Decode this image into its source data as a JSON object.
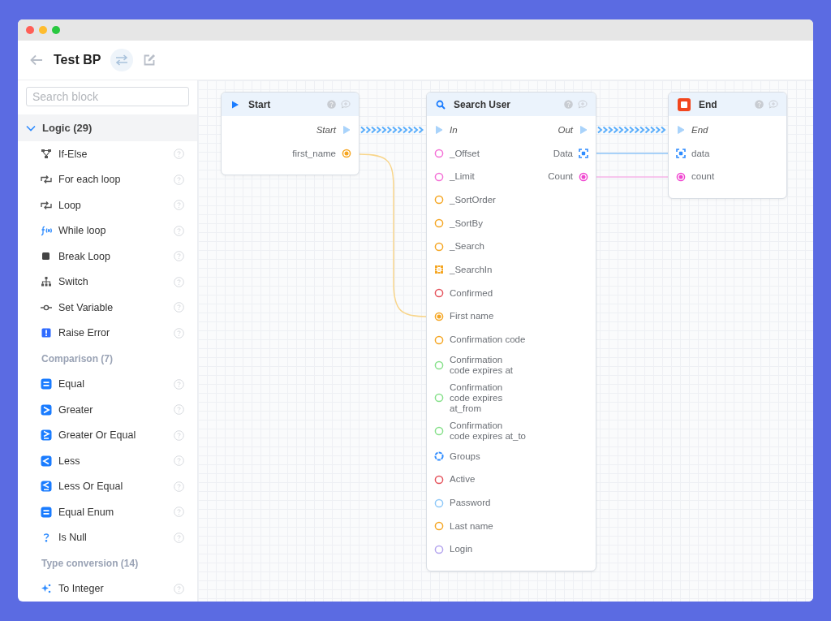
{
  "window": {
    "title": "Test BP"
  },
  "sidebar": {
    "search": {
      "placeholder": "Search block"
    },
    "categories": [
      {
        "title": "Logic (29)",
        "expanded": true,
        "sections": [
          {
            "items": [
              "If-Else",
              "For each loop",
              "Loop",
              "While loop",
              "Break Loop",
              "Switch",
              "Set Variable",
              "Raise Error"
            ]
          },
          {
            "title": "Comparison (7)",
            "items": [
              "Equal",
              "Greater",
              "Greater Or Equal",
              "Less",
              "Less Or Equal",
              "Equal Enum",
              "Is Null"
            ]
          },
          {
            "title": "Type conversion (14)",
            "items": [
              "To Integer"
            ]
          }
        ]
      }
    ]
  },
  "canvas": {
    "nodes": [
      {
        "kind": "start",
        "title": "Start",
        "outputs": [
          {
            "label": "Start",
            "kind": "exec",
            "connected": true
          },
          {
            "label": "first_name",
            "kind": "value",
            "color": "#f5a623",
            "connected": true
          }
        ]
      },
      {
        "kind": "action",
        "title": "Search User",
        "inputs": [
          {
            "label": "In",
            "kind": "exec",
            "connected": true
          },
          {
            "label": "_Offset",
            "kind": "value",
            "color": "#f46fd6",
            "connected": false
          },
          {
            "label": "_Limit",
            "kind": "value",
            "color": "#f46fd6",
            "connected": false
          },
          {
            "label": "_SortOrder",
            "kind": "value",
            "color": "#f5a623",
            "connected": false
          },
          {
            "label": "_SortBy",
            "kind": "value",
            "color": "#f5a623",
            "connected": false
          },
          {
            "label": "_Search",
            "kind": "value",
            "color": "#f5a623",
            "connected": false
          },
          {
            "label": "_SearchIn",
            "kind": "grid",
            "color": "#f5a623",
            "connected": false
          },
          {
            "label": "Confirmed",
            "kind": "value",
            "color": "#e5535c",
            "connected": false
          },
          {
            "label": "First name",
            "kind": "value",
            "color": "#f5a623",
            "connected": true
          },
          {
            "label": "Confirmation code",
            "kind": "value",
            "color": "#f5a623",
            "connected": false
          },
          {
            "label": "Confirmation\ncode expires at",
            "kind": "value",
            "color": "#86e08a",
            "connected": false
          },
          {
            "label": "Confirmation\ncode expires\nat_from",
            "kind": "value",
            "color": "#86e08a",
            "connected": false
          },
          {
            "label": "Confirmation\ncode expires at_to",
            "kind": "value",
            "color": "#86e08a",
            "connected": false
          },
          {
            "label": "Groups",
            "kind": "set",
            "color": "#2f8cff",
            "connected": false
          },
          {
            "label": "Active",
            "kind": "value",
            "color": "#e5535c",
            "connected": false
          },
          {
            "label": "Password",
            "kind": "value",
            "color": "#8ec8f8",
            "connected": false
          },
          {
            "label": "Last name",
            "kind": "value",
            "color": "#f5a623",
            "connected": false
          },
          {
            "label": "Login",
            "kind": "value",
            "color": "#b4a4ee",
            "connected": false
          }
        ],
        "outputs": [
          {
            "label": "Out",
            "kind": "exec",
            "connected": true
          },
          {
            "label": "Data",
            "kind": "object",
            "color": "#2f8cff",
            "connected": true
          },
          {
            "label": "Count",
            "kind": "value",
            "color": "#f046d0",
            "connected": true
          }
        ]
      },
      {
        "kind": "end",
        "title": "End",
        "inputs": [
          {
            "label": "End",
            "kind": "exec",
            "connected": true
          },
          {
            "label": "data",
            "kind": "object",
            "color": "#2f8cff",
            "connected": true
          },
          {
            "label": "count",
            "kind": "value",
            "color": "#f046d0",
            "connected": true
          }
        ]
      }
    ]
  }
}
